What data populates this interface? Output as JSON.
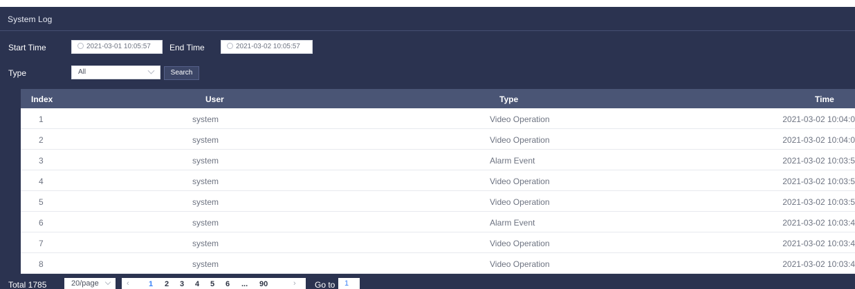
{
  "title": "System Log",
  "filters": {
    "start_label": "Start Time",
    "start_value": "2021-03-01 10:05:57",
    "end_label": "End Time",
    "end_value": "2021-03-02 10:05:57",
    "type_label": "Type",
    "type_value": "All",
    "search_label": "Search"
  },
  "table": {
    "headers": {
      "index": "Index",
      "user": "User",
      "type": "Type",
      "time": "Time"
    },
    "rows": [
      {
        "index": "1",
        "user": "system",
        "type": "Video Operation",
        "time": "2021-03-02 10:04:0"
      },
      {
        "index": "2",
        "user": "system",
        "type": "Video Operation",
        "time": "2021-03-02 10:04:0"
      },
      {
        "index": "3",
        "user": "system",
        "type": "Alarm Event",
        "time": "2021-03-02 10:03:5"
      },
      {
        "index": "4",
        "user": "system",
        "type": "Video Operation",
        "time": "2021-03-02 10:03:5"
      },
      {
        "index": "5",
        "user": "system",
        "type": "Video Operation",
        "time": "2021-03-02 10:03:5"
      },
      {
        "index": "6",
        "user": "system",
        "type": "Alarm Event",
        "time": "2021-03-02 10:03:4"
      },
      {
        "index": "7",
        "user": "system",
        "type": "Video Operation",
        "time": "2021-03-02 10:03:4"
      },
      {
        "index": "8",
        "user": "system",
        "type": "Video Operation",
        "time": "2021-03-02 10:03:4"
      }
    ]
  },
  "pagination": {
    "total": "Total 1785",
    "page_size": "20/page",
    "prev": "‹",
    "pages": [
      "1",
      "2",
      "3",
      "4",
      "5",
      "6",
      "...",
      "90"
    ],
    "next": "›",
    "goto_label": "Go to",
    "goto_value": "1",
    "accent": "#3b82f6"
  }
}
